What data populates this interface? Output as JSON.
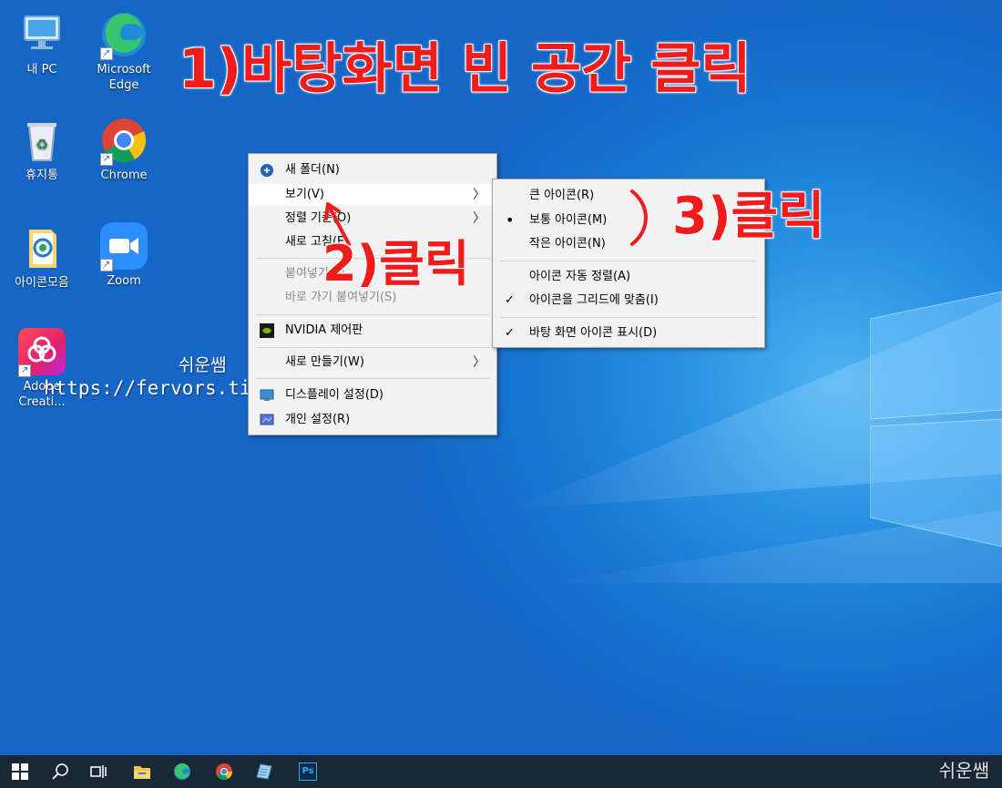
{
  "desktop_icons": [
    {
      "label": "내 PC",
      "icon": "this-pc-icon"
    },
    {
      "label": "Microsoft Edge",
      "icon": "edge-icon"
    },
    {
      "label": "휴지통",
      "icon": "recycle-bin-icon"
    },
    {
      "label": "Chrome",
      "icon": "chrome-icon"
    },
    {
      "label": "아이콘모음",
      "icon": "folder-icon"
    },
    {
      "label": "Zoom",
      "icon": "zoom-icon"
    },
    {
      "label": "Adobe Creati...",
      "icon": "adobe-cc-icon"
    }
  ],
  "context_menu": {
    "items": [
      {
        "label": "새 폴더(N)",
        "icon": "new-folder-icon",
        "enabled": true
      },
      {
        "label": "보기(V)",
        "submenu": true,
        "enabled": true,
        "highlighted": true
      },
      {
        "label": "정렬 기준(O)",
        "submenu": true,
        "enabled": true
      },
      {
        "label": "새로 고침(E)",
        "enabled": true
      },
      {
        "label": "붙여넣기(P)",
        "enabled": false
      },
      {
        "label": "바로 가기 붙여넣기(S)",
        "enabled": false
      },
      {
        "label": "NVIDIA 제어판",
        "icon": "nvidia-icon",
        "enabled": true
      },
      {
        "label": "새로 만들기(W)",
        "submenu": true,
        "enabled": true
      },
      {
        "label": "디스플레이 설정(D)",
        "icon": "display-icon",
        "enabled": true
      },
      {
        "label": "개인 설정(R)",
        "icon": "personalize-icon",
        "enabled": true
      }
    ]
  },
  "view_submenu": {
    "items": [
      {
        "label": "큰 아이콘(R)",
        "mark": ""
      },
      {
        "label": "보통 아이콘(M)",
        "mark": "•"
      },
      {
        "label": "작은 아이콘(N)",
        "mark": ""
      },
      {
        "label": "아이콘 자동 정렬(A)",
        "mark": ""
      },
      {
        "label": "아이콘을 그리드에 맞춤(I)",
        "mark": "✓"
      },
      {
        "label": "바탕 화면 아이콘 표시(D)",
        "mark": "✓"
      }
    ]
  },
  "annotations": {
    "step1": "1)바탕화면 빈 공간 클릭",
    "step2": "2)클릭",
    "step3": "3)클릭"
  },
  "watermark": {
    "name": "쉬운쌤",
    "url": "https://fervors.ti",
    "corner": "쉬운쌤"
  },
  "taskbar": {
    "items": [
      "start-button",
      "search-button",
      "task-view-button",
      "file-explorer",
      "edge",
      "chrome",
      "notepad-app",
      "photoshop"
    ],
    "photoshop_label": "Ps"
  },
  "colors": {
    "annotation_red": "#f01c1c",
    "taskbar": "#1a2835",
    "menu_bg": "#f2f2f2"
  }
}
